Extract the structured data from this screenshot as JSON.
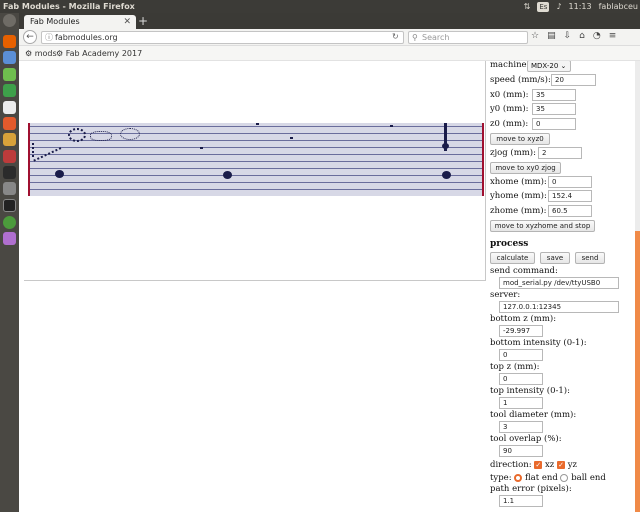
{
  "topbar": {
    "title": "Fab Modules - Mozilla Firefox",
    "time": "11:13",
    "lang": "Es",
    "user": "fablabceu"
  },
  "browser": {
    "tab_title": "Fab Modules",
    "url": "fabmodules.org",
    "search_placeholder": "Search",
    "bookmarks": [
      "mods",
      "Fab Academy 2017"
    ]
  },
  "panel": {
    "machine": {
      "label": "machine",
      "value": "MDX-20"
    },
    "speed": {
      "label": "speed (mm/s):",
      "value": "20"
    },
    "x0": {
      "label": "x0 (mm):",
      "value": "35"
    },
    "y0": {
      "label": "y0 (mm):",
      "value": "35"
    },
    "z0": {
      "label": "z0 (mm):",
      "value": "0"
    },
    "move_xyz0": "move to xyz0",
    "zjog": {
      "label": "zjog (mm):",
      "value": "2"
    },
    "move_xy0_zjog": "move to xy0 zjog",
    "xhome": {
      "label": "xhome (mm):",
      "value": "0"
    },
    "yhome": {
      "label": "yhome (mm):",
      "value": "152.4"
    },
    "zhome": {
      "label": "zhome (mm):",
      "value": "60.5"
    },
    "move_home": "move to xyzhome and stop",
    "process_title": "process",
    "calculate": "calculate",
    "save": "save",
    "send": "send",
    "send_command": {
      "label": "send command:",
      "value": "mod_serial.py /dev/ttyUSB0 9600"
    },
    "server": {
      "label": "server:",
      "value": "127.0.0.1:12345"
    },
    "bottom_z": {
      "label": "bottom z (mm):",
      "value": "-29.997"
    },
    "bottom_intensity": {
      "label": "bottom intensity (0-1):",
      "value": "0"
    },
    "top_z": {
      "label": "top z (mm):",
      "value": "0"
    },
    "top_intensity": {
      "label": "top intensity (0-1):",
      "value": "1"
    },
    "tool_diameter": {
      "label": "tool diameter (mm):",
      "value": "3"
    },
    "tool_overlap": {
      "label": "tool overlap (%):",
      "value": "90"
    },
    "direction": {
      "label": "direction:",
      "xz": "xz",
      "yz": "yz"
    },
    "type": {
      "label": "type:",
      "flat": "flat end",
      "ball": "ball end"
    },
    "path_error": {
      "label": "path error (pixels):",
      "value": "1.1"
    }
  },
  "colors": {
    "accent": "#e96a2c",
    "toolpath_bg": "#d7d8e6",
    "toolpath_line": "#6a6d9c",
    "edge": "#a01030"
  }
}
